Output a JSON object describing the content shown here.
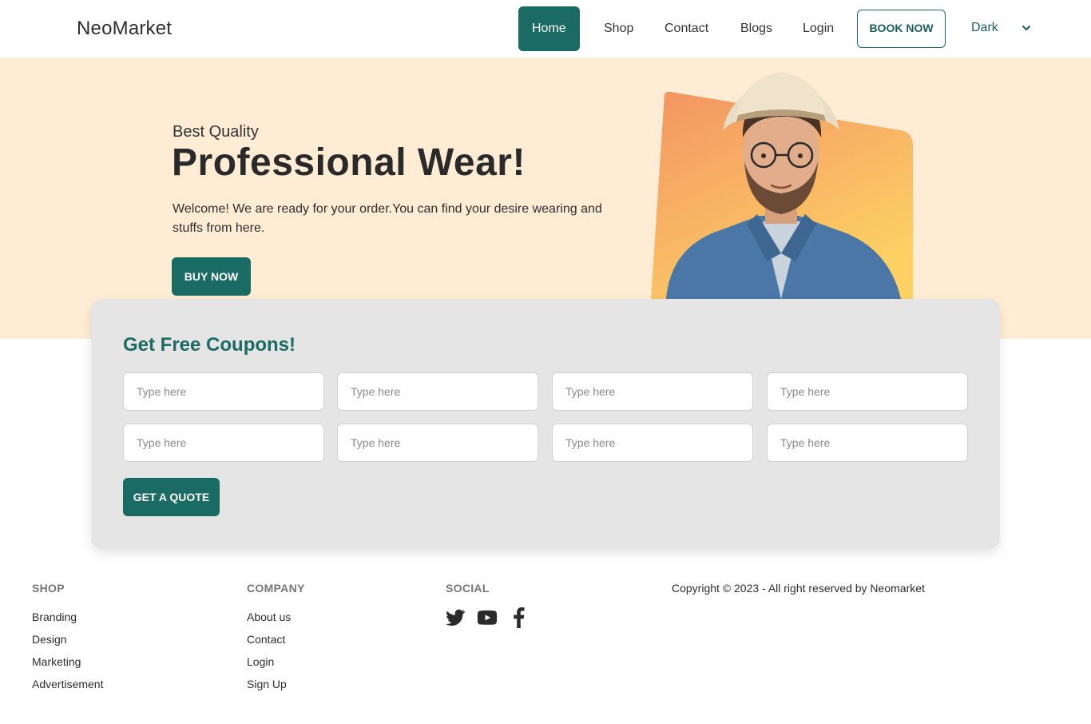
{
  "nav": {
    "brand": "NeoMarket",
    "items": [
      {
        "label": "Home",
        "active": true
      },
      {
        "label": "Shop",
        "active": false
      },
      {
        "label": "Contact",
        "active": false
      },
      {
        "label": "Blogs",
        "active": false
      },
      {
        "label": "Login",
        "active": false
      }
    ],
    "book_label": "BOOK NOW",
    "theme_value": "Dark"
  },
  "hero": {
    "subtitle": "Best Quality",
    "title": "Professional Wear!",
    "text": "Welcome! We are ready for your order.You can find your desire wearing and stuffs from here.",
    "buy_label": "BUY NOW"
  },
  "coupon": {
    "title": "Get Free Coupons!",
    "placeholder": "Type here",
    "quote_label": "GET A QUOTE"
  },
  "footer": {
    "shop": {
      "heading": "SHOP",
      "links": [
        "Branding",
        "Design",
        "Marketing",
        "Advertisement"
      ]
    },
    "company": {
      "heading": "COMPANY",
      "links": [
        "About us",
        "Contact",
        "Login",
        "Sign Up"
      ]
    },
    "social": {
      "heading": "SOCIAL",
      "icons": [
        "twitter-icon",
        "youtube-icon",
        "facebook-icon"
      ]
    },
    "copyright": "Copyright © 2023 - All right reserved by Neomarket"
  },
  "colors": {
    "primary": "#1a6b64",
    "hero_bg": "#feecd4",
    "card_bg": "#e5e5e5",
    "art_gradient_top": "#f39463",
    "art_gradient_bottom": "#fdd164"
  }
}
